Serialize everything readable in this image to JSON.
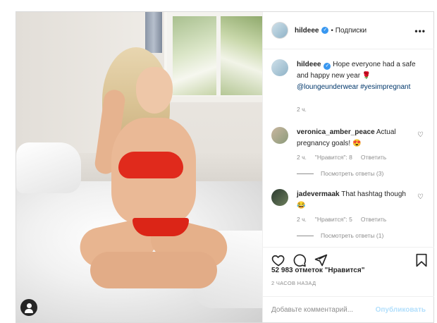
{
  "post": {
    "username": "hildeee",
    "dot": "•",
    "follow": "Подписки",
    "more": "•••"
  },
  "caption": {
    "username": "hildeee",
    "text": " Hope everyone had a safe and happy new year 🌹 ",
    "mention": "@loungeunderwear",
    "hashtag": "#yesimpregnant",
    "time": "2 ч."
  },
  "comments": [
    {
      "username": "veronica_amber_peace",
      "text": " Actual pregnancy goals! 😍",
      "time": "2 ч.",
      "likes": "\"Нравится\": 8",
      "reply": "Ответить",
      "view_replies": "Посмотреть ответы (3)"
    },
    {
      "username": "jadevermaak",
      "text": " That hashtag though 😂",
      "time": "2 ч.",
      "likes": "\"Нравится\": 5",
      "reply": "Ответить",
      "view_replies": "Посмотреть ответы (1)"
    }
  ],
  "likes_count": "52 983 отметок \"Нравится\"",
  "posted_time": "2 ЧАСОВ НАЗАД",
  "comment_box": {
    "placeholder": "Добавьте комментарий...",
    "publish_label": "Опубликовать"
  },
  "icons": [
    "heart-icon",
    "comment-icon",
    "share-icon",
    "bookmark-icon",
    "user-tag-icon",
    "more-icon",
    "verified-icon"
  ],
  "colors": {
    "verified": "#3897f0",
    "link": "#00376b",
    "muted": "#8e8e8e",
    "publish_disabled": "#b2dffc"
  }
}
